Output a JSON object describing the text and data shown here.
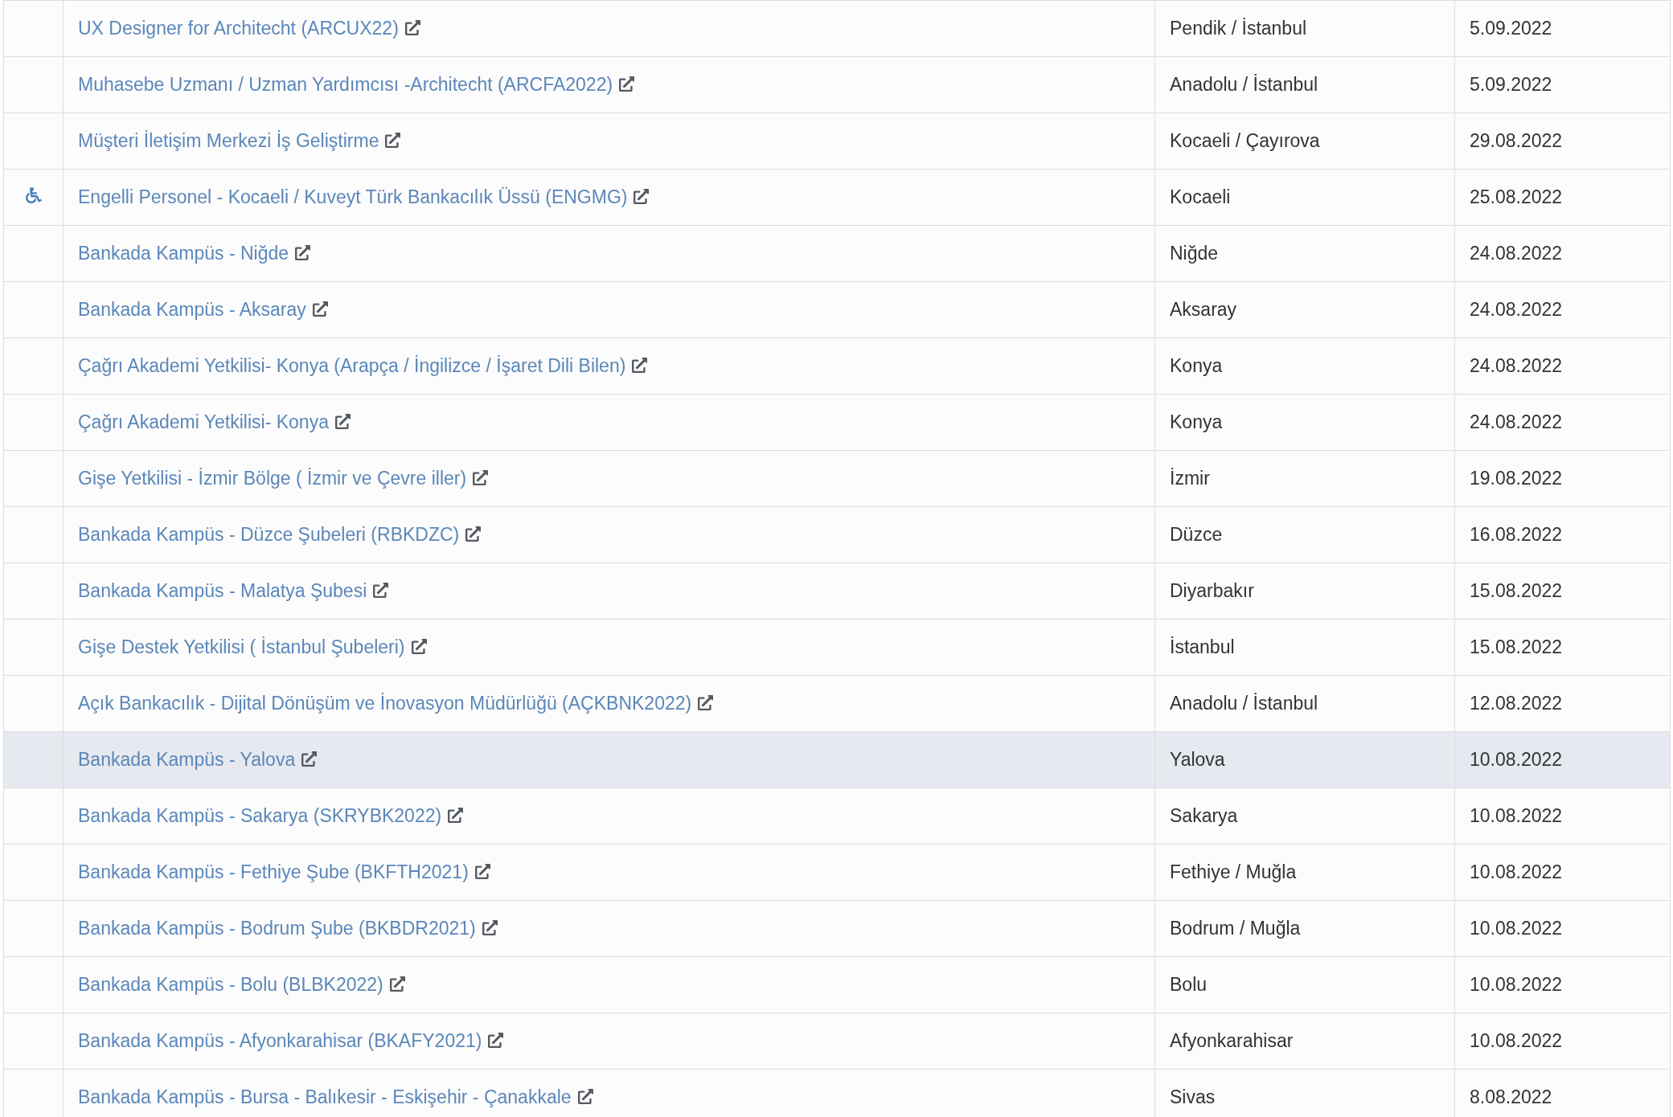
{
  "rows": [
    {
      "accessible": false,
      "highlighted": false,
      "title": "UX Designer for Architecht (ARCUX22)",
      "location": "Pendik / İstanbul",
      "date": "5.09.2022"
    },
    {
      "accessible": false,
      "highlighted": false,
      "title": "Muhasebe Uzmanı / Uzman Yardımcısı -Architecht (ARCFA2022)",
      "location": "Anadolu / İstanbul",
      "date": "5.09.2022"
    },
    {
      "accessible": false,
      "highlighted": false,
      "title": "Müşteri İletişim Merkezi İş Geliştirme",
      "location": "Kocaeli / Çayırova",
      "date": "29.08.2022"
    },
    {
      "accessible": true,
      "highlighted": false,
      "title": "Engelli Personel - Kocaeli / Kuveyt Türk Bankacılık Üssü (ENGMG)",
      "location": "Kocaeli",
      "date": "25.08.2022"
    },
    {
      "accessible": false,
      "highlighted": false,
      "title": "Bankada Kampüs - Niğde",
      "location": "Niğde",
      "date": "24.08.2022"
    },
    {
      "accessible": false,
      "highlighted": false,
      "title": "Bankada Kampüs - Aksaray",
      "location": "Aksaray",
      "date": "24.08.2022"
    },
    {
      "accessible": false,
      "highlighted": false,
      "title": "Çağrı Akademi Yetkilisi- Konya (Arapça / İngilizce / İşaret Dili Bilen)",
      "location": "Konya",
      "date": "24.08.2022"
    },
    {
      "accessible": false,
      "highlighted": false,
      "title": "Çağrı Akademi Yetkilisi- Konya",
      "location": "Konya",
      "date": "24.08.2022"
    },
    {
      "accessible": false,
      "highlighted": false,
      "title": "Gişe Yetkilisi - İzmir Bölge ( İzmir ve Çevre iller)",
      "location": "İzmir",
      "date": "19.08.2022"
    },
    {
      "accessible": false,
      "highlighted": false,
      "title": "Bankada Kampüs - Düzce Şubeleri (RBKDZC)",
      "location": "Düzce",
      "date": "16.08.2022"
    },
    {
      "accessible": false,
      "highlighted": false,
      "title": "Bankada Kampüs - Malatya Şubesi",
      "location": "Diyarbakır",
      "date": "15.08.2022"
    },
    {
      "accessible": false,
      "highlighted": false,
      "title": "Gişe Destek Yetkilisi ( İstanbul Şubeleri)",
      "location": "İstanbul",
      "date": "15.08.2022"
    },
    {
      "accessible": false,
      "highlighted": false,
      "title": "Açık Bankacılık - Dijital Dönüşüm ve İnovasyon Müdürlüğü (AÇKBNK2022)",
      "location": "Anadolu / İstanbul",
      "date": "12.08.2022"
    },
    {
      "accessible": false,
      "highlighted": true,
      "title": "Bankada Kampüs - Yalova",
      "location": "Yalova",
      "date": "10.08.2022"
    },
    {
      "accessible": false,
      "highlighted": false,
      "title": "Bankada Kampüs - Sakarya (SKRYBK2022)",
      "location": "Sakarya",
      "date": "10.08.2022"
    },
    {
      "accessible": false,
      "highlighted": false,
      "title": "Bankada Kampüs - Fethiye Şube (BKFTH2021)",
      "location": "Fethiye / Muğla",
      "date": "10.08.2022"
    },
    {
      "accessible": false,
      "highlighted": false,
      "title": "Bankada Kampüs - Bodrum Şube (BKBDR2021)",
      "location": "Bodrum / Muğla",
      "date": "10.08.2022"
    },
    {
      "accessible": false,
      "highlighted": false,
      "title": "Bankada Kampüs - Bolu (BLBK2022)",
      "location": "Bolu",
      "date": "10.08.2022"
    },
    {
      "accessible": false,
      "highlighted": false,
      "title": "Bankada Kampüs - Afyonkarahisar (BKAFY2021)",
      "location": "Afyonkarahisar",
      "date": "10.08.2022"
    },
    {
      "accessible": false,
      "highlighted": false,
      "title": "Bankada Kampüs - Bursa - Balıkesir - Eskişehir - Çanakkale",
      "location": "Sivas",
      "date": "8.08.2022"
    }
  ]
}
